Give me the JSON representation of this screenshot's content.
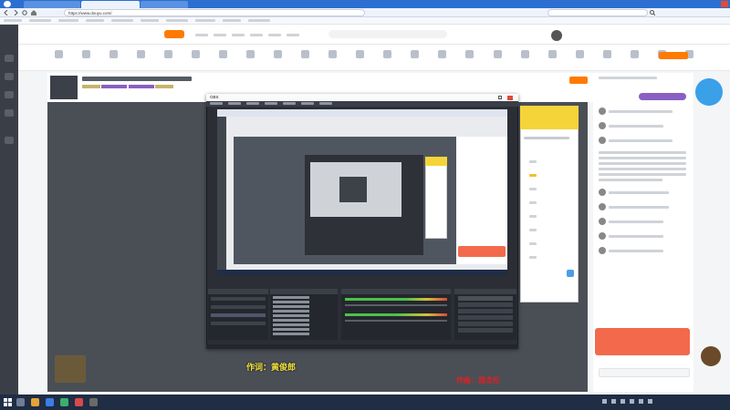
{
  "browser": {
    "url": "https://www.douyu.com/",
    "tabs": [
      {
        "label": "",
        "active": false
      },
      {
        "label": "",
        "active": true
      },
      {
        "label": "",
        "active": false
      }
    ]
  },
  "overlay": {
    "top_banner": "",
    "lyric_caption": "作词：黄俊郎",
    "composer_caption": "作曲：周杰伦"
  },
  "obs": {
    "window_title": "OBS"
  },
  "taskbar": {
    "clock_time": "",
    "clock_date": ""
  },
  "colors": {
    "browser_blue": "#2c6fd1",
    "obs_dark": "#2b2e35",
    "caption_yellow": "#f5e23b",
    "caption_red": "#e02020",
    "taskbar": "#1f2d45",
    "site_orange": "#ff7a00"
  }
}
